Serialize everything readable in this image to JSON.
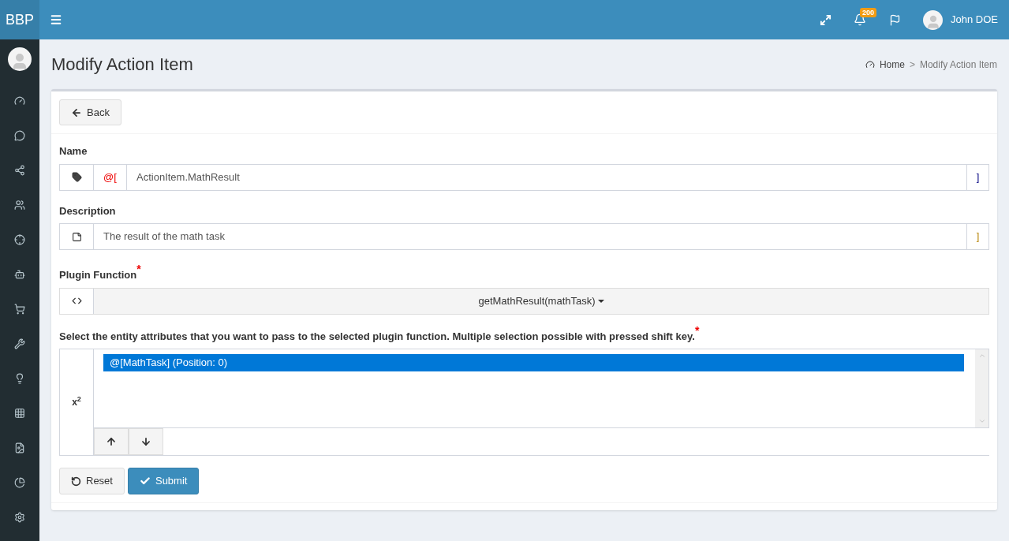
{
  "header": {
    "brand": "BBP",
    "notification_count": "200",
    "user_name": "John DOE"
  },
  "page": {
    "title": "Modify Action Item",
    "breadcrumb": [
      {
        "label": "Home"
      },
      {
        "label": "Modify Action Item"
      }
    ],
    "breadcrumb_separator": ">"
  },
  "back_button": "Back",
  "name_field": {
    "label": "Name",
    "prefix": "@[",
    "value": "ActionItem.MathResult",
    "suffix": "]"
  },
  "description_field": {
    "label": "Description",
    "value": "The result of the math task",
    "suffix": "]"
  },
  "plugin_function": {
    "label": "Plugin Function",
    "required_mark": "*",
    "value": "getMathResult(mathTask)"
  },
  "attributes": {
    "label": "Select the entity attributes that you want to pass to the selected plugin function. Multiple selection possible with pressed shift key.",
    "required_mark": "*",
    "addon": "x$^{2}$",
    "options": [
      {
        "label": "@[MathTask] (Position: 0)",
        "selected": true
      }
    ]
  },
  "buttons": {
    "reset": "Reset",
    "submit": "Submit"
  }
}
